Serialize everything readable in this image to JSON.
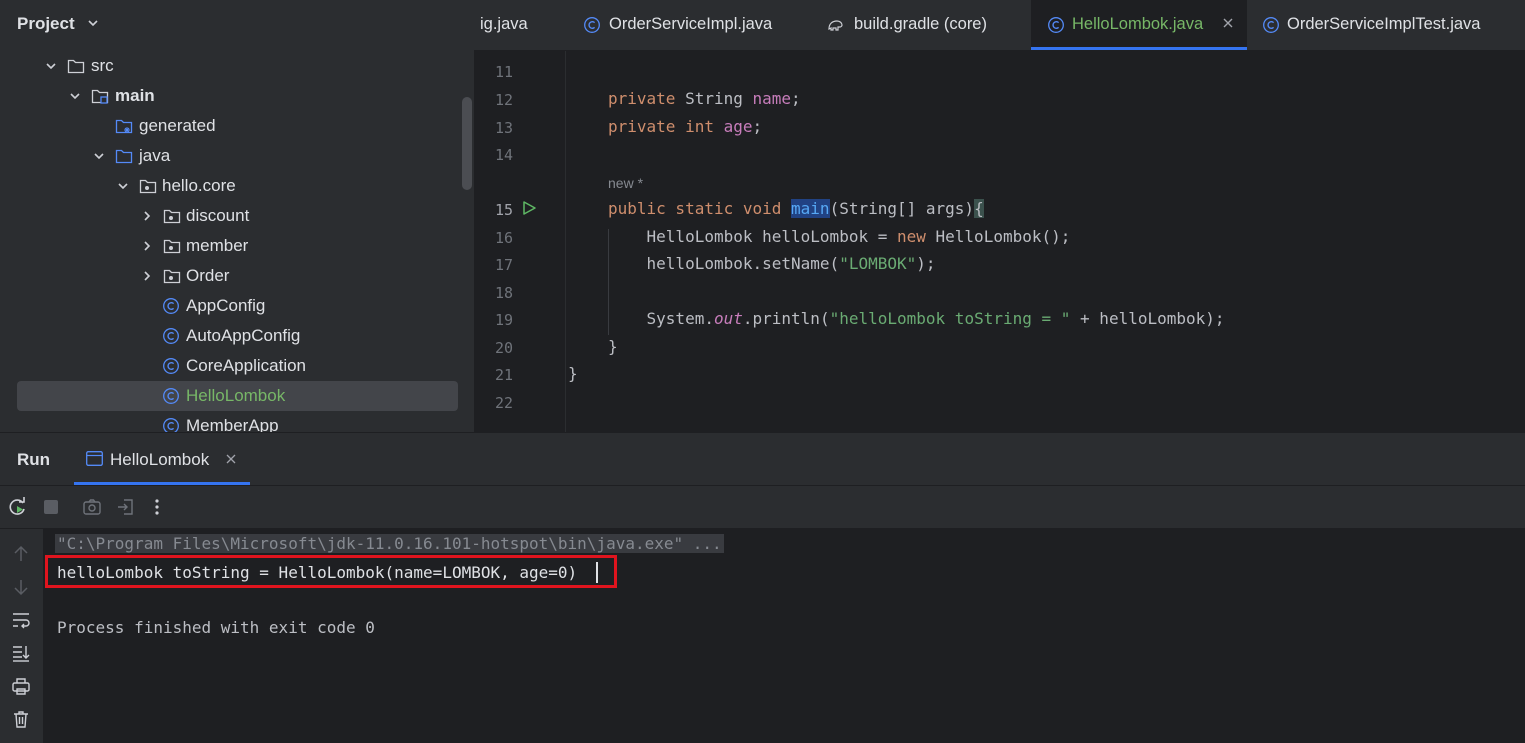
{
  "project_panel": {
    "title": "Project",
    "tree": [
      {
        "label": "src",
        "depth": 0,
        "expanded": true,
        "icon": "folder-icon"
      },
      {
        "label": "main",
        "depth": 1,
        "expanded": true,
        "icon": "source-root-folder-icon",
        "bold": true
      },
      {
        "label": "generated",
        "depth": 2,
        "icon": "generated-sources-folder-icon"
      },
      {
        "label": "java",
        "depth": 2,
        "expanded": true,
        "icon": "sources-folder-icon"
      },
      {
        "label": "hello.core",
        "depth": 3,
        "expanded": true,
        "icon": "package-icon"
      },
      {
        "label": "discount",
        "depth": 4,
        "expanded": false,
        "icon": "package-icon"
      },
      {
        "label": "member",
        "depth": 4,
        "expanded": false,
        "icon": "package-icon"
      },
      {
        "label": "Order",
        "depth": 4,
        "expanded": false,
        "icon": "package-icon"
      },
      {
        "label": "AppConfig",
        "depth": 4,
        "icon": "java-class-icon"
      },
      {
        "label": "AutoAppConfig",
        "depth": 4,
        "icon": "java-class-icon"
      },
      {
        "label": "CoreApplication",
        "depth": 4,
        "icon": "java-class-icon"
      },
      {
        "label": "HelloLombok",
        "depth": 4,
        "icon": "java-class-icon",
        "selected": true
      },
      {
        "label": "MemberApp",
        "depth": 4,
        "icon": "java-class-icon"
      }
    ]
  },
  "tabs": [
    {
      "label": "ig.java",
      "active": false
    },
    {
      "label": "OrderServiceImpl.java",
      "active": false,
      "icon": "java-class-icon"
    },
    {
      "label": "build.gradle (core)",
      "active": false,
      "icon": "gradle-icon"
    },
    {
      "label": "HelloLombok.java",
      "active": true,
      "icon": "java-class-icon"
    },
    {
      "label": "OrderServiceImplTest.java",
      "active": false,
      "icon": "java-class-icon"
    }
  ],
  "editor": {
    "current_line": 15,
    "hint_text": "new *",
    "lines": [
      {
        "n": "11"
      },
      {
        "n": "12"
      },
      {
        "n": "13"
      },
      {
        "n": "14"
      },
      {
        "n": "15"
      },
      {
        "n": "16"
      },
      {
        "n": "17"
      },
      {
        "n": "18"
      },
      {
        "n": "19"
      },
      {
        "n": "20"
      },
      {
        "n": "21"
      },
      {
        "n": "22"
      }
    ]
  },
  "run_panel": {
    "title": "Run",
    "tab_label": "HelloLombok",
    "console": {
      "command": "\"C:\\Program Files\\Microsoft\\jdk-11.0.16.101-hotspot\\bin\\java.exe\" ...",
      "output": "helloLombok toString = HelloLombok(name=LOMBOK, age=0)",
      "exit": "Process finished with exit code 0"
    }
  },
  "colors": {
    "accent": "#3574f0",
    "highlight_box": "#e0141e",
    "active_tab_text": "#77b767",
    "keyword": "#cf8e6d",
    "string": "#6aab73"
  }
}
